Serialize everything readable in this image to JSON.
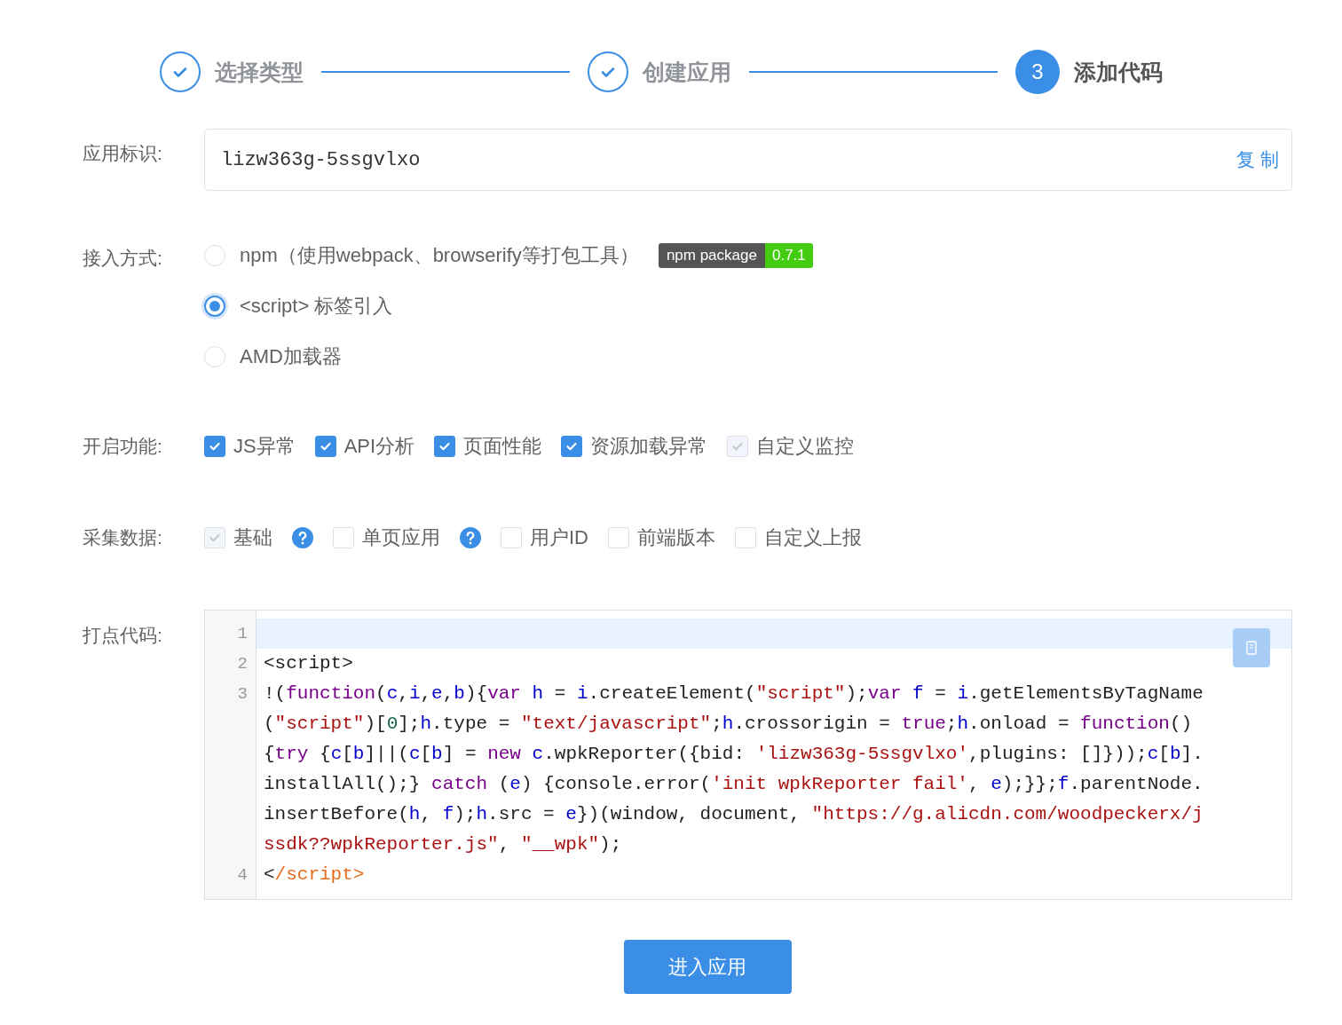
{
  "steps": [
    {
      "label": "选择类型",
      "done": true
    },
    {
      "label": "创建应用",
      "done": true
    },
    {
      "label": "添加代码",
      "done": false,
      "number": "3"
    }
  ],
  "app_id": {
    "label": "应用标识:",
    "value": "lizw363g-5ssgvlxo",
    "copy": "复 制"
  },
  "access": {
    "label": "接入方式:",
    "options": [
      {
        "label": "npm（使用webpack、browserify等打包工具）",
        "selected": false,
        "badge": {
          "name": "npm package",
          "version": "0.7.1"
        }
      },
      {
        "label": "<script> 标签引入",
        "selected": true
      },
      {
        "label": "AMD加载器",
        "selected": false
      }
    ]
  },
  "features": {
    "label": "开启功能:",
    "items": [
      {
        "label": "JS异常",
        "checked": true,
        "disabled": false
      },
      {
        "label": "API分析",
        "checked": true,
        "disabled": false
      },
      {
        "label": "页面性能",
        "checked": true,
        "disabled": false
      },
      {
        "label": "资源加载异常",
        "checked": true,
        "disabled": false
      },
      {
        "label": "自定义监控",
        "checked": true,
        "disabled": true
      }
    ]
  },
  "collect": {
    "label": "采集数据:",
    "items": [
      {
        "label": "基础",
        "checked": true,
        "disabled": true,
        "help": true
      },
      {
        "label": "单页应用",
        "checked": false,
        "disabled": false,
        "help": true
      },
      {
        "label": "用户ID",
        "checked": false,
        "disabled": false,
        "help": false
      },
      {
        "label": "前端版本",
        "checked": false,
        "disabled": false,
        "help": false
      },
      {
        "label": "自定义上报",
        "checked": false,
        "disabled": false,
        "help": false
      }
    ]
  },
  "code": {
    "label": "打点代码:",
    "lines": [
      {
        "number": "1",
        "active": true
      },
      {
        "number": "2",
        "active": false,
        "rows": [
          {
            "tokens": [
              {
                "kind": "plain",
                "text": "<script>"
              }
            ]
          }
        ]
      },
      {
        "number": "3",
        "active": false,
        "rows": [
          {
            "tokens": [
              {
                "kind": "plain",
                "text": "!("
              },
              {
                "kind": "keyword",
                "text": "function"
              },
              {
                "kind": "plain",
                "text": "("
              },
              {
                "kind": "variable",
                "text": "c"
              },
              {
                "kind": "plain",
                "text": ","
              },
              {
                "kind": "variable",
                "text": "i"
              },
              {
                "kind": "plain",
                "text": ","
              },
              {
                "kind": "variable",
                "text": "e"
              },
              {
                "kind": "plain",
                "text": ","
              },
              {
                "kind": "variable",
                "text": "b"
              },
              {
                "kind": "plain",
                "text": "){"
              },
              {
                "kind": "keyword",
                "text": "var "
              },
              {
                "kind": "variable",
                "text": "h"
              },
              {
                "kind": "plain",
                "text": " = "
              },
              {
                "kind": "variable",
                "text": "i"
              },
              {
                "kind": "plain",
                "text": ".createElement("
              },
              {
                "kind": "string",
                "text": "\"script\""
              },
              {
                "kind": "plain",
                "text": ");"
              },
              {
                "kind": "keyword",
                "text": "var "
              },
              {
                "kind": "variable",
                "text": "f"
              },
              {
                "kind": "plain",
                "text": " = "
              },
              {
                "kind": "variable",
                "text": "i"
              },
              {
                "kind": "plain",
                "text": ".getElementsByTagName"
              }
            ]
          },
          {
            "tokens": [
              {
                "kind": "plain",
                "text": "("
              },
              {
                "kind": "string",
                "text": "\"script\""
              },
              {
                "kind": "plain",
                "text": ")["
              },
              {
                "kind": "number",
                "text": "0"
              },
              {
                "kind": "plain",
                "text": "];"
              },
              {
                "kind": "variable",
                "text": "h"
              },
              {
                "kind": "plain",
                "text": ".type = "
              },
              {
                "kind": "string",
                "text": "\"text/javascript\""
              },
              {
                "kind": "plain",
                "text": ";"
              },
              {
                "kind": "variable",
                "text": "h"
              },
              {
                "kind": "plain",
                "text": ".crossorigin = "
              },
              {
                "kind": "keyword",
                "text": "true"
              },
              {
                "kind": "plain",
                "text": ";"
              },
              {
                "kind": "variable",
                "text": "h"
              },
              {
                "kind": "plain",
                "text": ".onload = "
              },
              {
                "kind": "keyword",
                "text": "function"
              },
              {
                "kind": "plain",
                "text": "()"
              }
            ]
          },
          {
            "tokens": [
              {
                "kind": "plain",
                "text": "{"
              },
              {
                "kind": "keyword",
                "text": "try"
              },
              {
                "kind": "plain",
                "text": " {"
              },
              {
                "kind": "variable",
                "text": "c"
              },
              {
                "kind": "plain",
                "text": "["
              },
              {
                "kind": "variable",
                "text": "b"
              },
              {
                "kind": "plain",
                "text": "]||("
              },
              {
                "kind": "variable",
                "text": "c"
              },
              {
                "kind": "plain",
                "text": "["
              },
              {
                "kind": "variable",
                "text": "b"
              },
              {
                "kind": "plain",
                "text": "] = "
              },
              {
                "kind": "keyword",
                "text": "new "
              },
              {
                "kind": "variable",
                "text": "c"
              },
              {
                "kind": "plain",
                "text": ".wpkReporter({bid: "
              },
              {
                "kind": "string",
                "text": "'lizw363g-5ssgvlxo'"
              },
              {
                "kind": "plain",
                "text": ",plugins: []}));"
              },
              {
                "kind": "variable",
                "text": "c"
              },
              {
                "kind": "plain",
                "text": "["
              },
              {
                "kind": "variable",
                "text": "b"
              },
              {
                "kind": "plain",
                "text": "]."
              }
            ]
          },
          {
            "tokens": [
              {
                "kind": "plain",
                "text": "installAll();} "
              },
              {
                "kind": "keyword",
                "text": "catch"
              },
              {
                "kind": "plain",
                "text": " ("
              },
              {
                "kind": "variable",
                "text": "e"
              },
              {
                "kind": "plain",
                "text": ") {console.error("
              },
              {
                "kind": "string",
                "text": "'init wpkReporter fail'"
              },
              {
                "kind": "plain",
                "text": ", "
              },
              {
                "kind": "variable",
                "text": "e"
              },
              {
                "kind": "plain",
                "text": ");}};"
              },
              {
                "kind": "variable",
                "text": "f"
              },
              {
                "kind": "plain",
                "text": ".parentNode."
              }
            ]
          },
          {
            "tokens": [
              {
                "kind": "plain",
                "text": "insertBefore("
              },
              {
                "kind": "variable",
                "text": "h"
              },
              {
                "kind": "plain",
                "text": ", "
              },
              {
                "kind": "variable",
                "text": "f"
              },
              {
                "kind": "plain",
                "text": ");"
              },
              {
                "kind": "variable",
                "text": "h"
              },
              {
                "kind": "plain",
                "text": ".src = "
              },
              {
                "kind": "variable",
                "text": "e"
              },
              {
                "kind": "plain",
                "text": "})(window, document, "
              },
              {
                "kind": "string",
                "text": "\"https://g.alicdn.com/woodpeckerx/j"
              }
            ]
          },
          {
            "tokens": [
              {
                "kind": "string",
                "text": "ssdk??wpkReporter.js\""
              },
              {
                "kind": "plain",
                "text": ", "
              },
              {
                "kind": "string",
                "text": "\"__wpk\""
              },
              {
                "kind": "plain",
                "text": ");"
              }
            ]
          }
        ]
      },
      {
        "number": "4",
        "active": false,
        "rows": [
          {
            "tokens": [
              {
                "kind": "plain",
                "text": "<"
              },
              {
                "kind": "tag",
                "text": "/script>"
              }
            ]
          }
        ]
      }
    ]
  },
  "submit": "进入应用"
}
